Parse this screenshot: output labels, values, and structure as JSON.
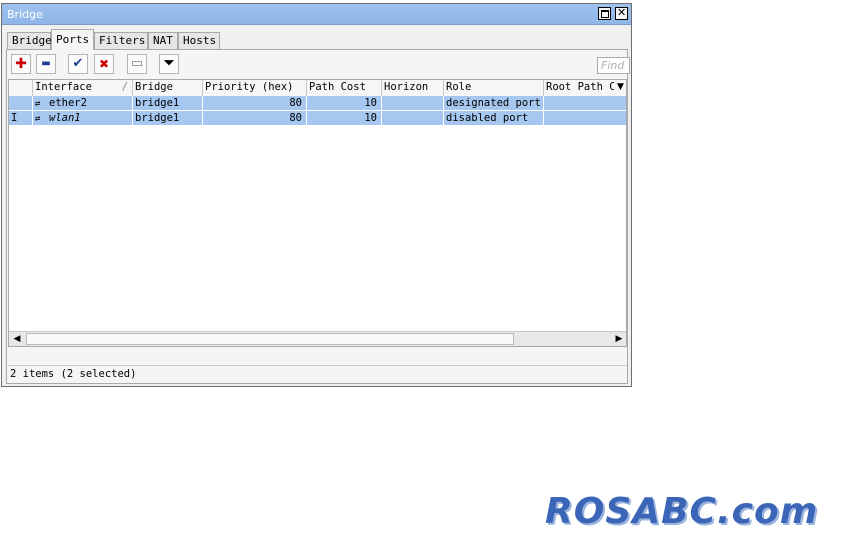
{
  "window": {
    "title": "Bridge"
  },
  "tabs": [
    {
      "label": "Bridge",
      "active": false
    },
    {
      "label": "Ports",
      "active": true
    },
    {
      "label": "Filters",
      "active": false
    },
    {
      "label": "NAT",
      "active": false
    },
    {
      "label": "Hosts",
      "active": false
    }
  ],
  "toolbar": {
    "buttons": [
      {
        "name": "add-button",
        "icon": "plus-icon",
        "glyph": "✚",
        "color": "#cc0000"
      },
      {
        "name": "remove-button",
        "icon": "minus-icon",
        "glyph": "▬",
        "color": "#1f3f8f"
      },
      {
        "name": "enable-button",
        "icon": "check-icon",
        "glyph": "✔",
        "color": "#1f3f8f"
      },
      {
        "name": "disable-button",
        "icon": "x-icon",
        "glyph": "✖",
        "color": "#cc0000"
      },
      {
        "name": "comment-button",
        "icon": "note-icon",
        "glyph": "▭",
        "color": "#808080"
      },
      {
        "name": "filter-button",
        "icon": "filter-icon",
        "glyph": "⏷",
        "color": "#000000"
      }
    ],
    "find_placeholder": "Find"
  },
  "table": {
    "columns": [
      "",
      "Interface",
      "Bridge",
      "Priority (hex)",
      "Path Cost",
      "Horizon",
      "Role",
      "Root Path C"
    ],
    "sort_indicator": "/",
    "rows": [
      {
        "flag": "",
        "interface": "ether2",
        "bridge": "bridge1",
        "priority": "80",
        "path_cost": "10",
        "horizon": "",
        "role": "designated port",
        "root_path": ""
      },
      {
        "flag": "I",
        "interface": "wlan1",
        "bridge": "bridge1",
        "priority": "80",
        "path_cost": "10",
        "horizon": "",
        "role": "disabled port",
        "root_path": ""
      }
    ],
    "selection_color": "#a6c7ef"
  },
  "status": {
    "text": "2 items (2 selected)"
  },
  "watermark": {
    "text": "ROSABC.com"
  }
}
